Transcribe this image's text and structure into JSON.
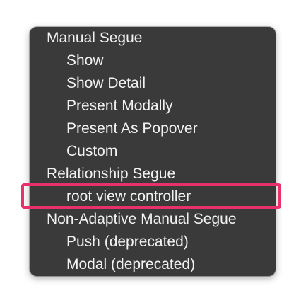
{
  "menu": {
    "colors": {
      "background": "#3a3a3a",
      "text": "#f2f2f2",
      "highlight": "#e8306a"
    },
    "sections": [
      {
        "header": "Manual Segue",
        "items": [
          "Show",
          "Show Detail",
          "Present Modally",
          "Present As Popover",
          "Custom"
        ]
      },
      {
        "header": "Relationship Segue",
        "items": [
          "root view controller"
        ]
      },
      {
        "header": "Non-Adaptive Manual Segue",
        "items": [
          "Push (deprecated)",
          "Modal (deprecated)"
        ]
      }
    ]
  }
}
